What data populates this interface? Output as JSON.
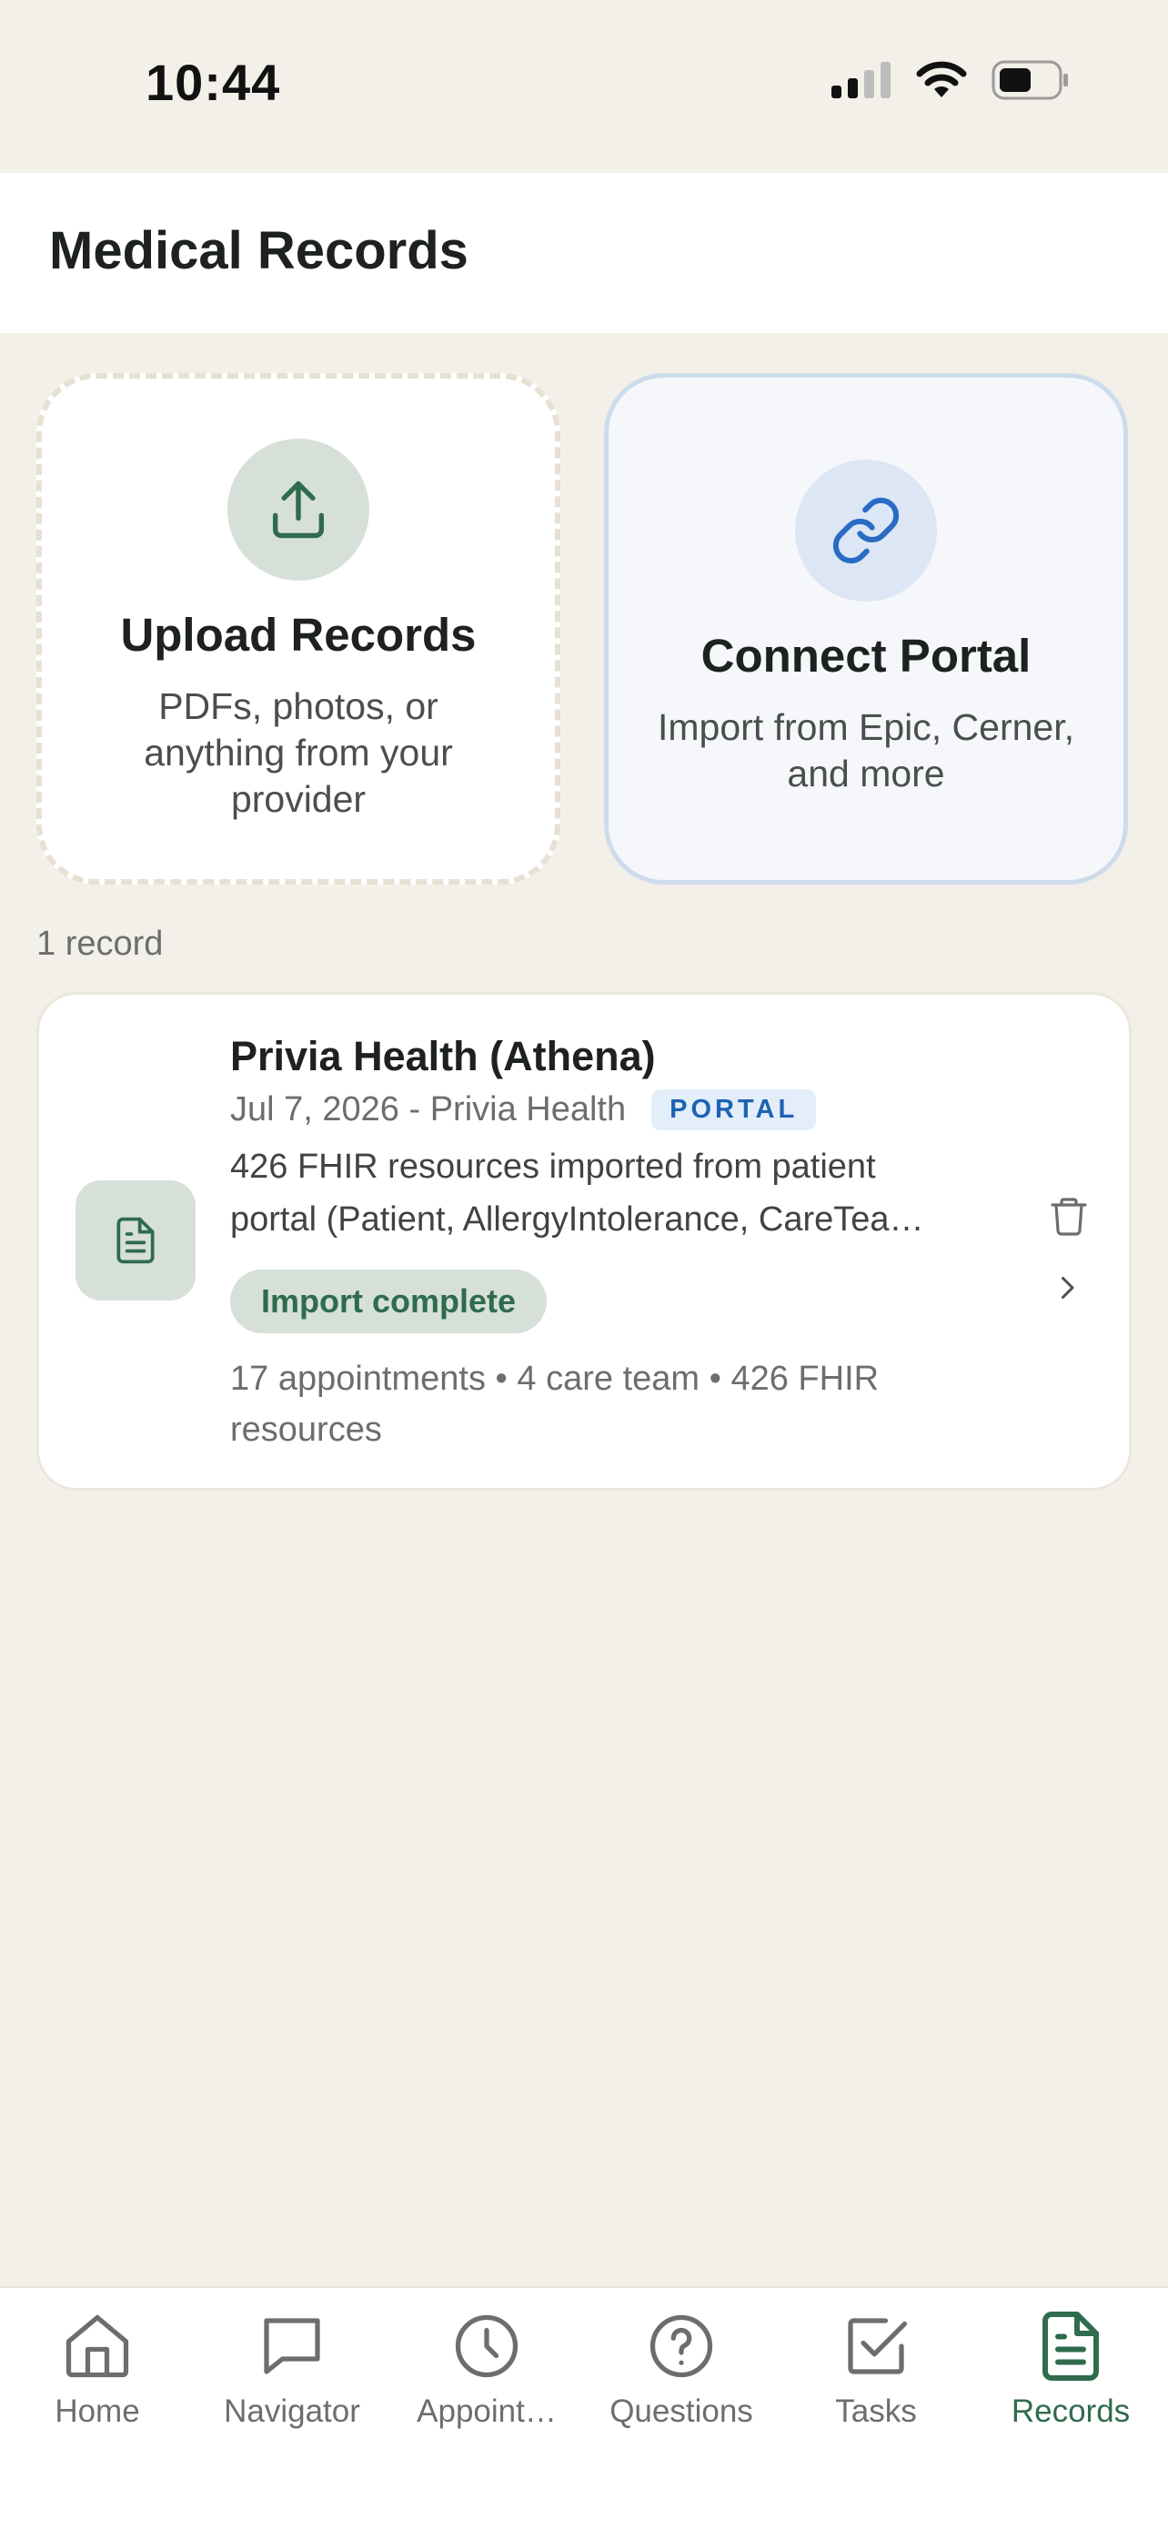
{
  "status_bar": {
    "time": "10:44",
    "icons": [
      "signal-icon",
      "wifi-icon",
      "battery-icon"
    ]
  },
  "header": {
    "title": "Medical Records"
  },
  "actions": {
    "upload": {
      "title": "Upload Records",
      "description": "PDFs, photos, or anything from your provider",
      "icon": "upload-icon"
    },
    "connect": {
      "title": "Connect Portal",
      "description": "Import from Epic, Cerner, and more",
      "icon": "link-icon"
    }
  },
  "records": {
    "count_label": "1 record",
    "items": [
      {
        "title": "Privia Health (Athena)",
        "meta": "Jul 7, 2026 - Privia Health",
        "badge": "PORTAL",
        "description_line1": "426 FHIR resources imported from patient",
        "description_line2": "portal (Patient, AllergyIntolerance, CareTea…",
        "status": "Import complete",
        "stats": "17 appointments • 4 care team • 426 FHIR resources"
      }
    ]
  },
  "tab_bar": {
    "active": "Records",
    "tabs": [
      {
        "label": "Home",
        "icon": "home-icon"
      },
      {
        "label": "Navigator",
        "icon": "chat-icon"
      },
      {
        "label": "Appoint…",
        "icon": "clock-icon"
      },
      {
        "label": "Questions",
        "icon": "question-icon"
      },
      {
        "label": "Tasks",
        "icon": "checkbox-icon"
      },
      {
        "label": "Records",
        "icon": "document-icon"
      }
    ]
  },
  "colors": {
    "background": "#F3EFE9",
    "accent_green": "#2F6B4D",
    "portal_blue": "#1D63B3",
    "link_blue": "#2A6BC4"
  }
}
